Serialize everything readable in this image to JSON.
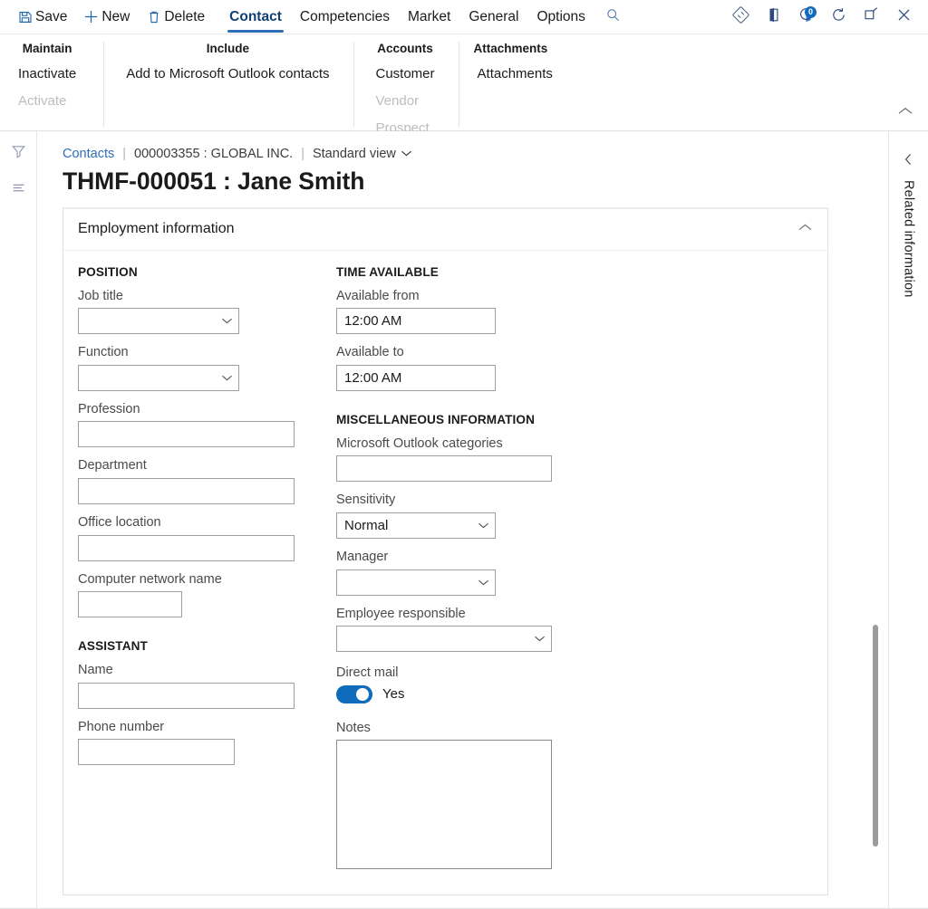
{
  "commandbar": {
    "buttons": [
      {
        "label": "Save",
        "icon": "save-icon"
      },
      {
        "label": "New",
        "icon": "plus-icon"
      },
      {
        "label": "Delete",
        "icon": "trash-icon"
      }
    ],
    "tabs": [
      {
        "label": "Contact",
        "active": true
      },
      {
        "label": "Competencies",
        "active": false
      },
      {
        "label": "Market",
        "active": false
      },
      {
        "label": "General",
        "active": false
      },
      {
        "label": "Options",
        "active": false
      }
    ],
    "search_icon": "search-icon",
    "right_icons": [
      {
        "name": "dynamics-diamond-icon"
      },
      {
        "name": "office-app-launcher-icon"
      },
      {
        "name": "notifications-icon",
        "badge": "0"
      },
      {
        "name": "refresh-icon"
      },
      {
        "name": "popout-icon"
      },
      {
        "name": "close-icon"
      }
    ]
  },
  "actionpane": {
    "collapse_icon": "chevron-up-icon",
    "groups": [
      {
        "title": "Maintain",
        "buttons": [
          {
            "label": "Inactivate",
            "disabled": false
          },
          {
            "label": "Activate",
            "disabled": true
          }
        ]
      },
      {
        "title": "Include",
        "buttons": [
          {
            "label": "Add to Microsoft Outlook contacts",
            "disabled": false
          }
        ]
      },
      {
        "title": "Accounts",
        "buttons": [
          {
            "label": "Customer",
            "disabled": false
          },
          {
            "label": "Vendor",
            "disabled": true
          },
          {
            "label": "Prospect",
            "disabled": true
          }
        ]
      },
      {
        "title": "Attachments",
        "buttons": [
          {
            "label": "Attachments",
            "disabled": false
          }
        ]
      }
    ]
  },
  "leftstrip": {
    "icons": [
      {
        "name": "filter-icon"
      },
      {
        "name": "list-lines-icon"
      }
    ]
  },
  "breadcrumb": {
    "root": "Contacts",
    "separator": "|",
    "record": "000003355 : GLOBAL INC.",
    "view": "Standard view",
    "view_chevron": "chevron-down-icon"
  },
  "page_title": "THMF-000051 : Jane Smith",
  "panel": {
    "title": "Employment information",
    "chevron": "chevron-up-icon",
    "left_column": {
      "groups": [
        {
          "heading": "POSITION",
          "fields": [
            {
              "label": "Job title",
              "value": "",
              "type": "combobox"
            },
            {
              "label": "Function",
              "value": "",
              "type": "combobox"
            },
            {
              "label": "Profession",
              "value": "",
              "type": "text"
            },
            {
              "label": "Department",
              "value": "",
              "type": "text"
            },
            {
              "label": "Office location",
              "value": "",
              "type": "text"
            },
            {
              "label": "Computer network name",
              "value": "",
              "type": "text"
            }
          ]
        },
        {
          "heading": "ASSISTANT",
          "fields": [
            {
              "label": "Name",
              "value": "",
              "type": "text"
            },
            {
              "label": "Phone number",
              "value": "",
              "type": "text"
            }
          ]
        }
      ]
    },
    "right_column": {
      "groups": [
        {
          "heading": "TIME AVAILABLE",
          "fields": [
            {
              "label": "Available from",
              "value": "12:00 AM",
              "type": "text"
            },
            {
              "label": "Available to",
              "value": "12:00 AM",
              "type": "text"
            }
          ]
        },
        {
          "heading": "MISCELLANEOUS INFORMATION",
          "fields": [
            {
              "label": "Microsoft Outlook categories",
              "value": "",
              "type": "text"
            },
            {
              "label": "Sensitivity",
              "value": "Normal",
              "type": "combobox"
            },
            {
              "label": "Manager",
              "value": "",
              "type": "combobox"
            },
            {
              "label": "Employee responsible",
              "value": "",
              "type": "combobox"
            },
            {
              "label": "Direct mail",
              "value": "Yes",
              "type": "toggle",
              "toggle_on": true
            },
            {
              "label": "Notes",
              "value": "",
              "type": "textarea"
            }
          ]
        }
      ]
    }
  },
  "rightrail": {
    "chevron": "chevron-left-icon",
    "label": "Related information"
  },
  "colors": {
    "accent": "#0f6cbd",
    "tab_underline": "#2e6fb7",
    "link": "#2e6fb7",
    "toggle_on": "#0f6cbd",
    "disabled_text": "#bdbdbd",
    "border": "#9e9e9e"
  }
}
